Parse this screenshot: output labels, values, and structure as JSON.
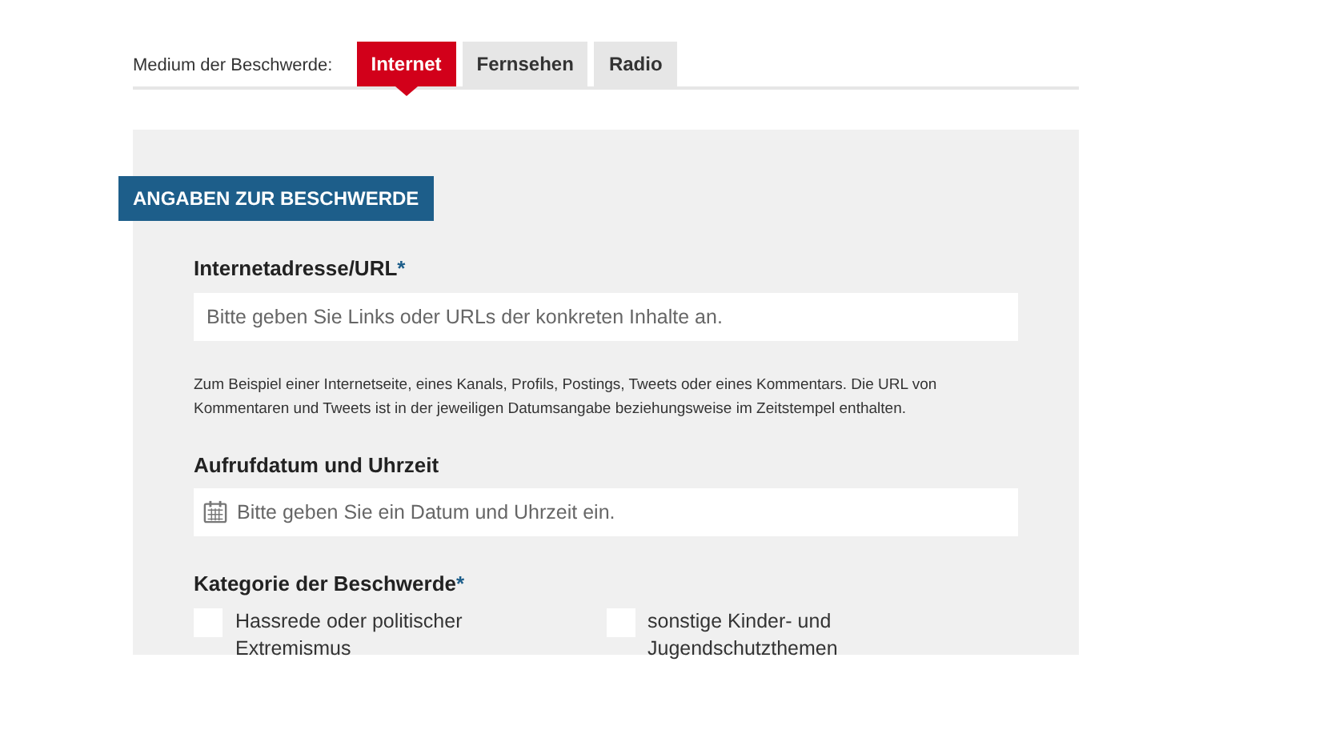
{
  "medium": {
    "label": "Medium der Beschwerde:",
    "tabs": [
      {
        "label": "Internet",
        "selected": true
      },
      {
        "label": "Fernsehen",
        "selected": false
      },
      {
        "label": "Radio",
        "selected": false
      }
    ]
  },
  "section": {
    "title": "ANGABEN ZUR BESCHWERDE",
    "url_field": {
      "label": "Internetadresse/URL",
      "required_mark": "*",
      "placeholder": "Bitte geben Sie Links oder URLs der konkreten Inhalte an.",
      "hint": "Zum Beispiel einer Internetseite, eines Kanals, Profils, Postings, Tweets oder eines Kommentars. Die URL von Kommentaren und Tweets ist in der jeweiligen Datumsangabe beziehungsweise im Zeitstempel enthalten."
    },
    "date_field": {
      "label": "Aufrufdatum und Uhrzeit",
      "placeholder": "Bitte geben Sie ein Datum und Uhrzeit ein."
    },
    "category": {
      "label": "Kategorie der Beschwerde",
      "required_mark": "*",
      "options": [
        {
          "label": "Hassrede oder politischer Extremismus",
          "checked": false
        },
        {
          "label": "sonstige Kinder- und Jugendschutzthemen",
          "checked": false
        }
      ]
    }
  }
}
